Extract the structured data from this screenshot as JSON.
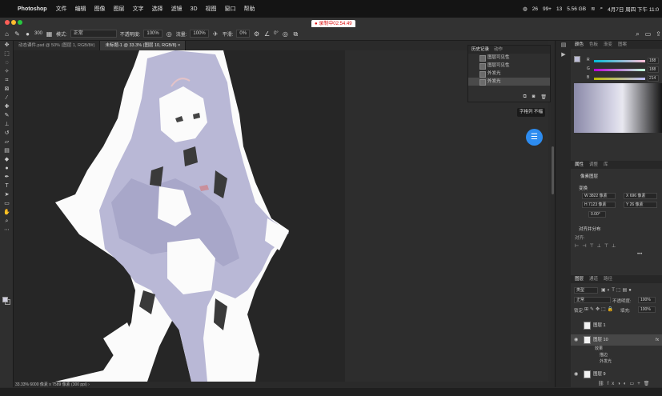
{
  "menubar": {
    "app_name": "Photoshop",
    "menus": [
      "文件",
      "编辑",
      "图像",
      "图层",
      "文字",
      "选择",
      "滤镜",
      "3D",
      "视图",
      "窗口",
      "帮助"
    ],
    "status": [
      "26",
      "99+",
      "13",
      "5.56 GB",
      "4月7日 周四 下午 11:0"
    ]
  },
  "recording": "● 录制中02:54:49",
  "options": {
    "brush_size": "300",
    "mode_label": "模式:",
    "mode_value": "正常",
    "opacity_label": "不透明度:",
    "opacity_value": "100%",
    "flow_label": "流量:",
    "flow_value": "100%",
    "smooth_label": "平滑:",
    "smooth_value": "0%",
    "angle_value": "0°"
  },
  "tabs": [
    {
      "label": "动态课件.psd @ 50% (图层 1, RGB/8#)"
    },
    {
      "label": "未标题-1 @ 33.3% (图层 10, RGB/8) ×"
    }
  ],
  "history": {
    "tab_history": "历史记录",
    "tab_actions": "动作",
    "rows": [
      "图层可见性",
      "图层可见性",
      "外发光",
      "外发光"
    ]
  },
  "tooltip": "字格列  不幅",
  "color_panel": {
    "tabs": [
      "颜色",
      "色板",
      "渐变",
      "图案"
    ],
    "r_label": "R",
    "r_value": "188",
    "g_label": "G",
    "g_value": "188",
    "b_label": "B",
    "b_value": "214"
  },
  "properties": {
    "tabs": [
      "属性",
      "调整",
      "库"
    ],
    "section_pixel": "像素图层",
    "section_transform": "变换",
    "w_value": "W 3822 像素",
    "x_value": "X 696 像素",
    "h_value": "H 7123 像素",
    "y_value": "Y 26 像素",
    "angle_value": "0.00°",
    "section_align": "对齐并分布",
    "align_label": "对齐:"
  },
  "layers": {
    "tabs": [
      "图层",
      "通道",
      "路径"
    ],
    "kind_label": "类型",
    "blend_mode": "正常",
    "opacity_label": "不透明度:",
    "opacity_value": "100%",
    "lock_label": "锁定:",
    "fill_label": "填充:",
    "fill_value": "100%",
    "rows": [
      {
        "name": "图层 1"
      },
      {
        "name": "图层 10"
      },
      {
        "name": "图层 9"
      }
    ],
    "effects_label": "效果",
    "fx1": "描边",
    "fx2": "外发光"
  },
  "statusbar": "33.33%   6000 像素 x 7589 像素 (300 ppi)   ›"
}
